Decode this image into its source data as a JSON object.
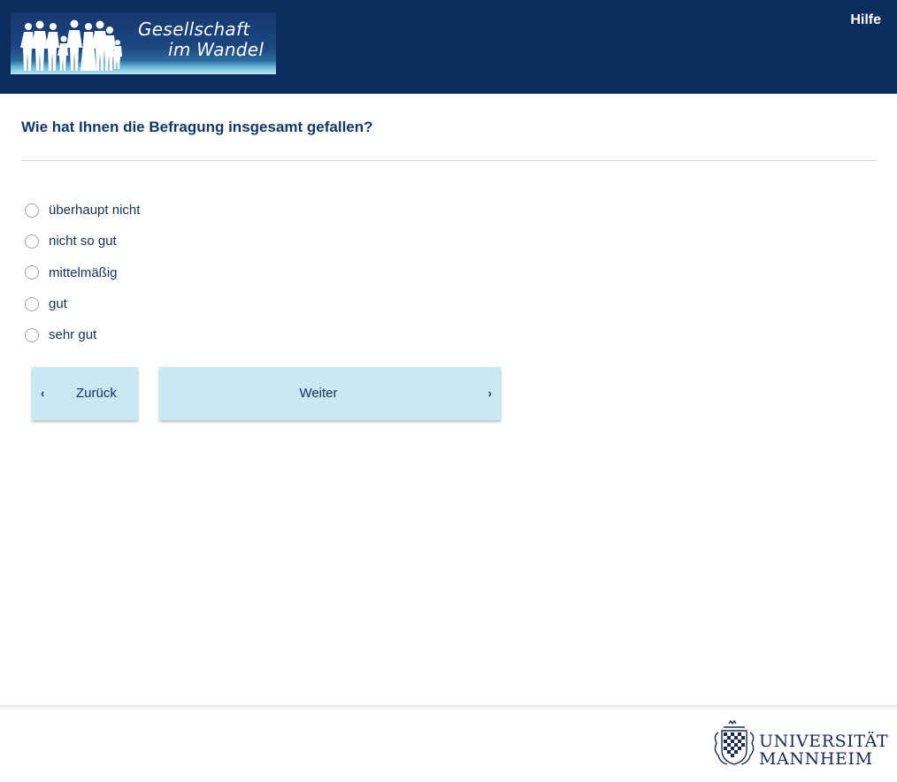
{
  "header": {
    "logo": {
      "line1": "Gesellschaft",
      "line2": "im Wandel"
    },
    "help_label": "Hilfe"
  },
  "question": {
    "text": "Wie hat Ihnen die Befragung insgesamt gefallen?",
    "options": [
      {
        "label": "überhaupt nicht",
        "selected": false
      },
      {
        "label": "nicht so gut",
        "selected": false
      },
      {
        "label": "mittelmäßig",
        "selected": false
      },
      {
        "label": "gut",
        "selected": false
      },
      {
        "label": "sehr gut",
        "selected": false
      }
    ]
  },
  "navigation": {
    "back_label": "Zurück",
    "next_label": "Weiter"
  },
  "footer": {
    "university_line1": "UNIVERSITÄT",
    "university_line2": "MANNHEIM"
  },
  "colors": {
    "header_bg": "#0e2d5f",
    "question_text": "#12386b",
    "button_bg": "#c8e8f4"
  },
  "icons": [
    "chevron-left-icon",
    "chevron-right-icon",
    "family-silhouette-icon",
    "university-seal-icon"
  ]
}
